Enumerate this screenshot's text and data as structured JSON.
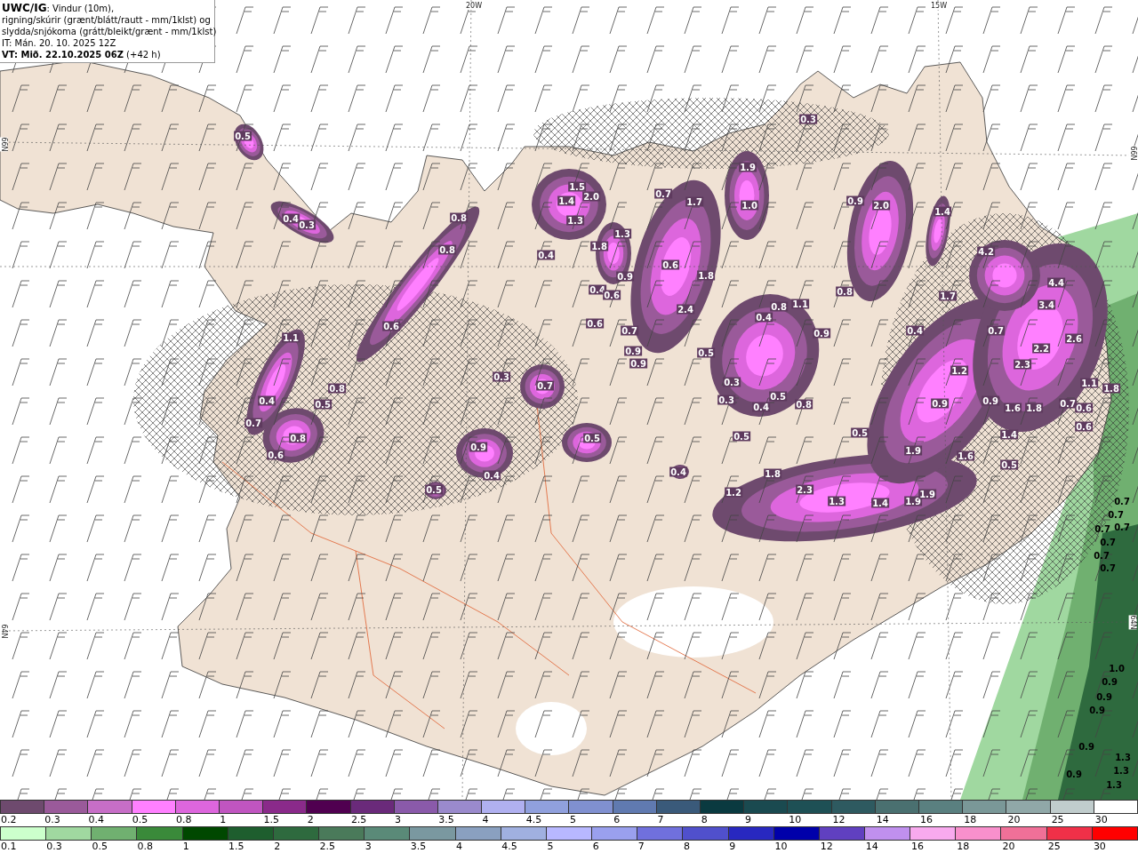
{
  "header": {
    "lines": [
      "**UWC/IG**: Vindur (10m),",
      "rigning/skúrir (grænt/blátt/rautt - mm/1klst) og",
      "slydda/snjókoma (grátt/bleikt/grænt - mm/1klst)",
      "IT: Mán. 20. 10. 2025 12Z",
      "**VT: Mið. 22.10.2025 06Z** (+42 h)"
    ]
  },
  "map": {
    "axis_labels": [
      {
        "text": "20W",
        "kind": "lon"
      },
      {
        "text": "15W",
        "kind": "lon"
      },
      {
        "text": "66N",
        "kind": "lat"
      },
      {
        "text": "66N",
        "kind": "lat"
      },
      {
        "text": "64N",
        "kind": "lat"
      },
      {
        "text": "64N",
        "kind": "lat"
      }
    ],
    "labels": [
      {
        "text": "0.5",
        "kind": "snow"
      },
      {
        "text": "0.4",
        "kind": "snow"
      },
      {
        "text": "0.3",
        "kind": "snow"
      },
      {
        "text": "0.8",
        "kind": "snow"
      },
      {
        "text": "0.8",
        "kind": "snow"
      },
      {
        "text": "1.5",
        "kind": "snow"
      },
      {
        "text": "2.0",
        "kind": "snow"
      },
      {
        "text": "1.4",
        "kind": "snow"
      },
      {
        "text": "1.3",
        "kind": "snow"
      },
      {
        "text": "1.3",
        "kind": "snow"
      },
      {
        "text": "1.8",
        "kind": "snow"
      },
      {
        "text": "0.4",
        "kind": "snow"
      },
      {
        "text": "0.9",
        "kind": "snow"
      },
      {
        "text": "0.4",
        "kind": "snow"
      },
      {
        "text": "0.6",
        "kind": "snow"
      },
      {
        "text": "0.6",
        "kind": "snow"
      },
      {
        "text": "0.7",
        "kind": "snow"
      },
      {
        "text": "0.9",
        "kind": "snow"
      },
      {
        "text": "0.9",
        "kind": "snow"
      },
      {
        "text": "1.1",
        "kind": "snow"
      },
      {
        "text": "0.6",
        "kind": "snow"
      },
      {
        "text": "0.3",
        "kind": "snow"
      },
      {
        "text": "0.8",
        "kind": "snow"
      },
      {
        "text": "0.7",
        "kind": "snow"
      },
      {
        "text": "0.4",
        "kind": "snow"
      },
      {
        "text": "0.5",
        "kind": "snow"
      },
      {
        "text": "0.7",
        "kind": "snow"
      },
      {
        "text": "0.8",
        "kind": "snow"
      },
      {
        "text": "0.6",
        "kind": "snow"
      },
      {
        "text": "0.9",
        "kind": "snow"
      },
      {
        "text": "0.4",
        "kind": "snow"
      },
      {
        "text": "0.5",
        "kind": "snow"
      },
      {
        "text": "0.5",
        "kind": "snow"
      },
      {
        "text": "0.3",
        "kind": "snow"
      },
      {
        "text": "0.7",
        "kind": "snow"
      },
      {
        "text": "1.7",
        "kind": "snow"
      },
      {
        "text": "1.9",
        "kind": "snow"
      },
      {
        "text": "1.0",
        "kind": "snow"
      },
      {
        "text": "0.9",
        "kind": "snow"
      },
      {
        "text": "2.0",
        "kind": "snow"
      },
      {
        "text": "1.4",
        "kind": "snow"
      },
      {
        "text": "0.6",
        "kind": "snow"
      },
      {
        "text": "1.8",
        "kind": "snow"
      },
      {
        "text": "4.2",
        "kind": "snow"
      },
      {
        "text": "2.4",
        "kind": "snow"
      },
      {
        "text": "0.8",
        "kind": "snow"
      },
      {
        "text": "1.1",
        "kind": "snow"
      },
      {
        "text": "0.4",
        "kind": "snow"
      },
      {
        "text": "0.8",
        "kind": "snow"
      },
      {
        "text": "1.7",
        "kind": "snow"
      },
      {
        "text": "4.4",
        "kind": "snow"
      },
      {
        "text": "3.4",
        "kind": "snow"
      },
      {
        "text": "0.9",
        "kind": "snow"
      },
      {
        "text": "0.4",
        "kind": "snow"
      },
      {
        "text": "0.7",
        "kind": "snow"
      },
      {
        "text": "2.6",
        "kind": "snow"
      },
      {
        "text": "0.5",
        "kind": "snow"
      },
      {
        "text": "2.2",
        "kind": "snow"
      },
      {
        "text": "2.3",
        "kind": "snow"
      },
      {
        "text": "1.2",
        "kind": "snow"
      },
      {
        "text": "0.3",
        "kind": "snow"
      },
      {
        "text": "1.1",
        "kind": "snow"
      },
      {
        "text": "1.8",
        "kind": "snow"
      },
      {
        "text": "0.3",
        "kind": "snow"
      },
      {
        "text": "0.5",
        "kind": "snow"
      },
      {
        "text": "0.4",
        "kind": "snow"
      },
      {
        "text": "0.8",
        "kind": "snow"
      },
      {
        "text": "0.9",
        "kind": "snow"
      },
      {
        "text": "0.9",
        "kind": "snow"
      },
      {
        "text": "1.6",
        "kind": "snow"
      },
      {
        "text": "1.8",
        "kind": "snow"
      },
      {
        "text": "0.7",
        "kind": "snow"
      },
      {
        "text": "0.6",
        "kind": "snow"
      },
      {
        "text": "0.6",
        "kind": "snow"
      },
      {
        "text": "0.5",
        "kind": "snow"
      },
      {
        "text": "0.5",
        "kind": "snow"
      },
      {
        "text": "1.4",
        "kind": "snow"
      },
      {
        "text": "1.9",
        "kind": "snow"
      },
      {
        "text": "1.6",
        "kind": "snow"
      },
      {
        "text": "0.5",
        "kind": "snow"
      },
      {
        "text": "0.4",
        "kind": "snow"
      },
      {
        "text": "1.8",
        "kind": "snow"
      },
      {
        "text": "1.2",
        "kind": "snow"
      },
      {
        "text": "2.3",
        "kind": "snow"
      },
      {
        "text": "1.3",
        "kind": "snow"
      },
      {
        "text": "1.4",
        "kind": "snow"
      },
      {
        "text": "1.9",
        "kind": "snow"
      },
      {
        "text": "1.9",
        "kind": "snow"
      },
      {
        "text": "0.7",
        "kind": "rain"
      },
      {
        "text": "0.7",
        "kind": "rain"
      },
      {
        "text": "0.7",
        "kind": "rain"
      },
      {
        "text": "0.7",
        "kind": "rain"
      },
      {
        "text": "0.7",
        "kind": "rain"
      },
      {
        "text": "0.7",
        "kind": "rain"
      },
      {
        "text": "0.7",
        "kind": "rain"
      },
      {
        "text": "1.0",
        "kind": "rain"
      },
      {
        "text": "0.9",
        "kind": "rain"
      },
      {
        "text": "0.9",
        "kind": "rain"
      },
      {
        "text": "0.9",
        "kind": "rain"
      },
      {
        "text": "0.9",
        "kind": "rain"
      },
      {
        "text": "0.9",
        "kind": "rain"
      },
      {
        "text": "1.3",
        "kind": "rain"
      },
      {
        "text": "1.3",
        "kind": "rain"
      },
      {
        "text": "1.3",
        "kind": "rain"
      }
    ]
  },
  "color_scales": [
    {
      "bins": [
        {
          "label": "0.2",
          "color": "#6e4a6e"
        },
        {
          "label": "0.3",
          "color": "#9a5a9a"
        },
        {
          "label": "0.4",
          "color": "#c76ec7"
        },
        {
          "label": "0.5",
          "color": "#ff80ff"
        },
        {
          "label": "0.8",
          "color": "#dd66dd"
        },
        {
          "label": "1",
          "color": "#c055c0"
        },
        {
          "label": "1.5",
          "color": "#8a2a8a"
        },
        {
          "label": "2",
          "color": "#500050"
        },
        {
          "label": "2.5",
          "color": "#6a2a7a"
        },
        {
          "label": "3",
          "color": "#8a5aaa"
        },
        {
          "label": "3.5",
          "color": "#9a8acc"
        },
        {
          "label": "4",
          "color": "#b0b0f0"
        },
        {
          "label": "4.5",
          "color": "#90a0dd"
        },
        {
          "label": "5",
          "color": "#8090d0"
        },
        {
          "label": "6",
          "color": "#607ab0"
        },
        {
          "label": "7",
          "color": "#3a5a7a"
        },
        {
          "label": "8",
          "color": "#0a3a40"
        },
        {
          "label": "9",
          "color": "#1a4a50"
        },
        {
          "label": "10",
          "color": "#1e5055"
        },
        {
          "label": "12",
          "color": "#2e5a60"
        },
        {
          "label": "14",
          "color": "#4a7070"
        },
        {
          "label": "16",
          "color": "#5a8080"
        },
        {
          "label": "18",
          "color": "#7a9898"
        },
        {
          "label": "20",
          "color": "#90a8a8"
        },
        {
          "label": "25",
          "color": "#c0cccc"
        },
        {
          "label": "30",
          "color": "#ffffff"
        }
      ]
    },
    {
      "bins": [
        {
          "label": "0.1",
          "color": "#ccffcc"
        },
        {
          "label": "0.3",
          "color": "#a0d8a0"
        },
        {
          "label": "0.5",
          "color": "#70b070"
        },
        {
          "label": "0.8",
          "color": "#3a8a3a"
        },
        {
          "label": "1",
          "color": "#004800"
        },
        {
          "label": "1.5",
          "color": "#1e5e2e"
        },
        {
          "label": "2",
          "color": "#2e6a3e"
        },
        {
          "label": "2.5",
          "color": "#4a7a5a"
        },
        {
          "label": "3",
          "color": "#5a8a78"
        },
        {
          "label": "3.5",
          "color": "#7a98a0"
        },
        {
          "label": "4",
          "color": "#8aa0c0"
        },
        {
          "label": "4.5",
          "color": "#a0b0e0"
        },
        {
          "label": "5",
          "color": "#b8b8ff"
        },
        {
          "label": "6",
          "color": "#9aa0ee"
        },
        {
          "label": "7",
          "color": "#7070dd"
        },
        {
          "label": "8",
          "color": "#5050cc"
        },
        {
          "label": "9",
          "color": "#2828c0"
        },
        {
          "label": "10",
          "color": "#0000aa"
        },
        {
          "label": "12",
          "color": "#6040c0"
        },
        {
          "label": "14",
          "color": "#c090ee"
        },
        {
          "label": "16",
          "color": "#f8aaee"
        },
        {
          "label": "18",
          "color": "#f890cc"
        },
        {
          "label": "20",
          "color": "#f07098"
        },
        {
          "label": "25",
          "color": "#f03048"
        },
        {
          "label": "30",
          "color": "#ff0000"
        }
      ]
    }
  ]
}
